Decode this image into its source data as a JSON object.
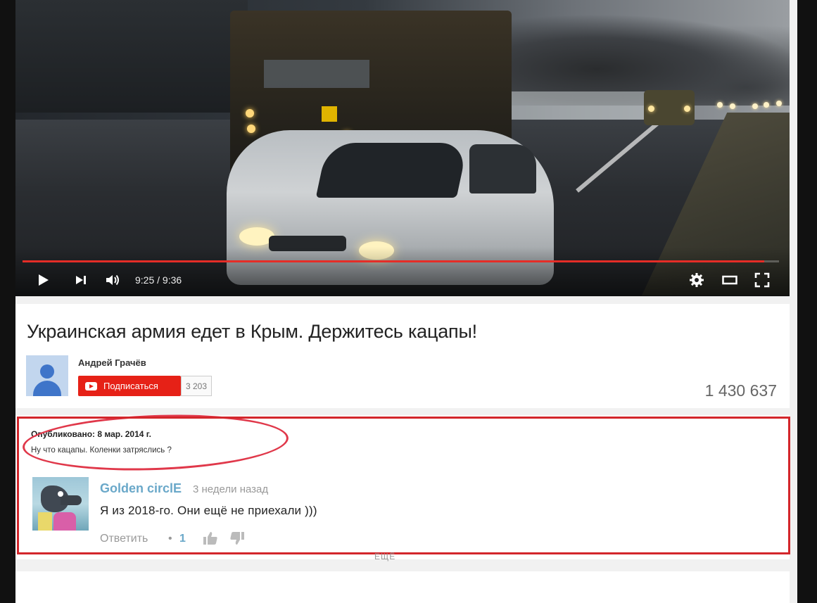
{
  "video": {
    "time": "9:25 / 9:36",
    "progress": 0.98,
    "controls": {
      "play": "play-icon",
      "next": "next-icon",
      "volume": "volume-icon",
      "settings": "gear-icon",
      "theater": "theater-icon",
      "fullscreen": "fullscreen-icon"
    }
  },
  "info": {
    "title": "Украинская армия едет в Крым. Держитесь кацапы!",
    "author": "Андрей Грачёв",
    "subscribe_label": "Подписаться",
    "subscriber_count": "3 203",
    "views": "1 430 637"
  },
  "description": {
    "published": "Опубликовано: 8 мар. 2014 г.",
    "text": "Ну что кацапы. Коленки затряслись ?"
  },
  "comment": {
    "author": "Golden circlE",
    "date": "3 недели назад",
    "text": "Я из 2018-го. Они ещё не приехали  )))",
    "reply_label": "Ответить",
    "separator": "•",
    "likes": "1"
  },
  "more_label": "ЕЩЁ",
  "colors": {
    "accent_red": "#e62117",
    "annotation_red": "#d3262b",
    "link_blue": "#6aa8c9"
  }
}
